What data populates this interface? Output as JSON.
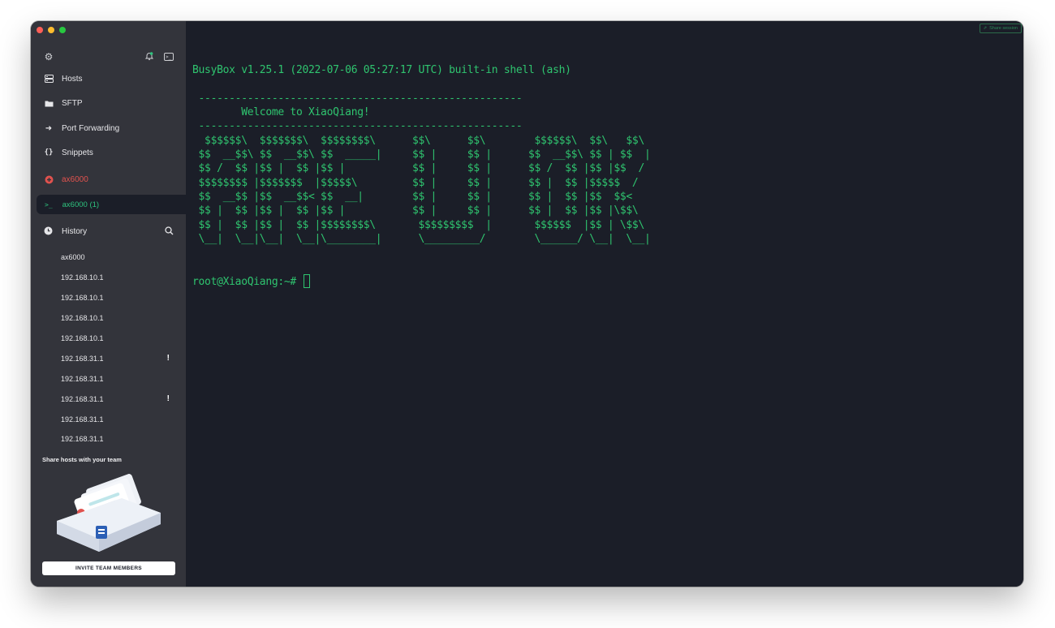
{
  "window": {
    "traffic_lights": [
      "close",
      "minimize",
      "zoom"
    ]
  },
  "colors": {
    "accent_green": "#2fc46f",
    "session_red": "#e0524e",
    "sidebar_bg": "#33343b",
    "terminal_bg": "#1b1e28"
  },
  "sidebar": {
    "top_icons": [
      "gear-icon",
      "bell-icon",
      "terminal-icon"
    ],
    "nav": [
      {
        "label": "Hosts",
        "icon": "hosts-icon"
      },
      {
        "label": "SFTP",
        "icon": "folder-icon"
      },
      {
        "label": "Port Forwarding",
        "icon": "forward-arrow-icon"
      },
      {
        "label": "Snippets",
        "icon": "braces-icon"
      }
    ],
    "session": {
      "label": "ax6000",
      "icon": "host-badge-icon"
    },
    "active_tab": {
      "label": "ax6000 (1)",
      "icon": "prompt-icon"
    },
    "history": {
      "title": "History",
      "items": [
        {
          "label": "ax6000",
          "warn": ""
        },
        {
          "label": "192.168.10.1",
          "warn": ""
        },
        {
          "label": "192.168.10.1",
          "warn": ""
        },
        {
          "label": "192.168.10.1",
          "warn": ""
        },
        {
          "label": "192.168.10.1",
          "warn": ""
        },
        {
          "label": "192.168.31.1",
          "warn": "!"
        },
        {
          "label": "192.168.31.1",
          "warn": ""
        },
        {
          "label": "192.168.31.1",
          "warn": "!"
        },
        {
          "label": "192.168.31.1",
          "warn": ""
        },
        {
          "label": "192.168.31.1",
          "warn": ""
        }
      ]
    },
    "share": {
      "title": "Share hosts with your team",
      "invite_label": "INVITE TEAM MEMBERS"
    }
  },
  "terminal": {
    "share_session_label": "Share session",
    "lines": [
      "BusyBox v1.25.1 (2022-07-06 05:27:17 UTC) built-in shell (ash)",
      "",
      " -----------------------------------------------------",
      "        Welcome to XiaoQiang!",
      " -----------------------------------------------------",
      "  $$$$$$\\  $$$$$$$\\  $$$$$$$$\\      $$\\      $$\\        $$$$$$\\  $$\\   $$\\",
      " $$  __$$\\ $$  __$$\\ $$  _____|     $$ |     $$ |      $$  __$$\\ $$ | $$  |",
      " $$ /  $$ |$$ |  $$ |$$ |           $$ |     $$ |      $$ /  $$ |$$ |$$  /",
      " $$$$$$$$ |$$$$$$$  |$$$$$\\         $$ |     $$ |      $$ |  $$ |$$$$$  /",
      " $$  __$$ |$$  __$$< $$  __|        $$ |     $$ |      $$ |  $$ |$$  $$<",
      " $$ |  $$ |$$ |  $$ |$$ |           $$ |     $$ |      $$ |  $$ |$$ |\\$$\\",
      " $$ |  $$ |$$ |  $$ |$$$$$$$$\\       $$$$$$$$$  |       $$$$$$  |$$ | \\$$\\",
      " \\__|  \\__|\\__|  \\__|\\________|      \\_________/        \\______/ \\__|  \\__|",
      "",
      ""
    ],
    "prompt": "root@XiaoQiang:~#"
  }
}
